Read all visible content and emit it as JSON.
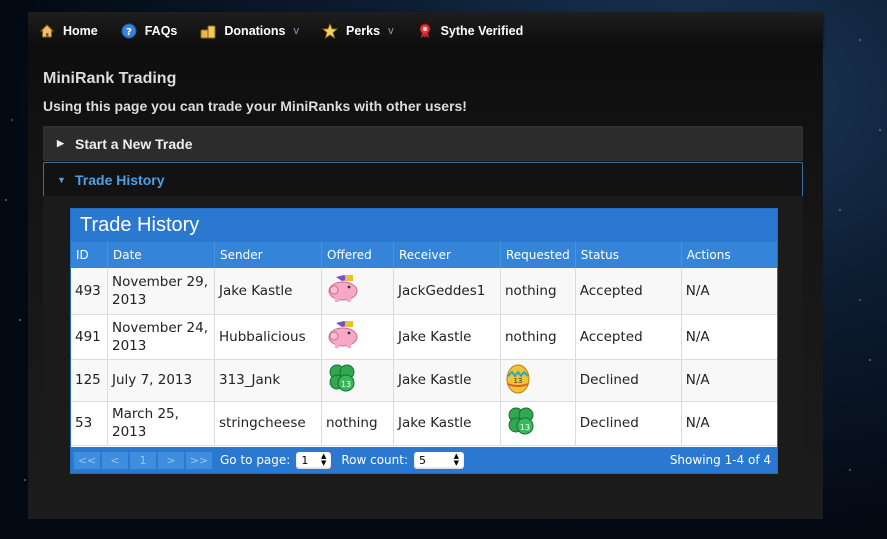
{
  "nav": {
    "items": [
      {
        "label": "Home",
        "icon": "house-icon",
        "caret": ""
      },
      {
        "label": "FAQs",
        "icon": "question-icon",
        "caret": ""
      },
      {
        "label": "Donations",
        "icon": "coins-icon",
        "caret": "v"
      },
      {
        "label": "Perks",
        "icon": "star-icon",
        "caret": "v"
      },
      {
        "label": "Sythe Verified",
        "icon": "ribbon-icon",
        "caret": ""
      }
    ]
  },
  "page": {
    "title": "MiniRank Trading",
    "subtitle": "Using this page you can trade your MiniRanks with other users!"
  },
  "accordion": {
    "new_trade": "Start a New Trade",
    "trade_history": "Trade History"
  },
  "table": {
    "caption": "Trade History",
    "columns": [
      "ID",
      "Date",
      "Sender",
      "Offered",
      "Receiver",
      "Requested",
      "Status",
      "Actions"
    ],
    "rows": [
      {
        "id": "493",
        "date": "November 29, 2013",
        "sender": "Jake Kastle",
        "offered": "pig-icon",
        "receiver": "JackGeddes1",
        "requested": "nothing",
        "status": "Accepted",
        "actions": "N/A"
      },
      {
        "id": "491",
        "date": "November 24, 2013",
        "sender": "Hubbalicious",
        "offered": "pig-icon",
        "receiver": "Jake Kastle",
        "requested": "nothing",
        "status": "Accepted",
        "actions": "N/A"
      },
      {
        "id": "125",
        "date": "July 7, 2013",
        "sender": "313_Jank",
        "offered": "clover-13-icon",
        "receiver": "Jake Kastle",
        "requested": "egg-13-icon",
        "status": "Declined",
        "actions": "N/A"
      },
      {
        "id": "53",
        "date": "March 25, 2013",
        "sender": "stringcheese",
        "offered": "nothing",
        "receiver": "Jake Kastle",
        "requested": "clover-13-icon",
        "status": "Declined",
        "actions": "N/A"
      }
    ]
  },
  "pager": {
    "first": "<<",
    "prev": "<",
    "page": "1",
    "next": ">",
    "last": ">>",
    "goto_label": "Go to page:",
    "goto_value": "1",
    "rowcount_label": "Row count:",
    "rowcount_value": "5",
    "showing": "Showing 1-4 of 4"
  },
  "colors": {
    "table_header": "#2a78d0",
    "accent_link": "#4ea0e6"
  }
}
